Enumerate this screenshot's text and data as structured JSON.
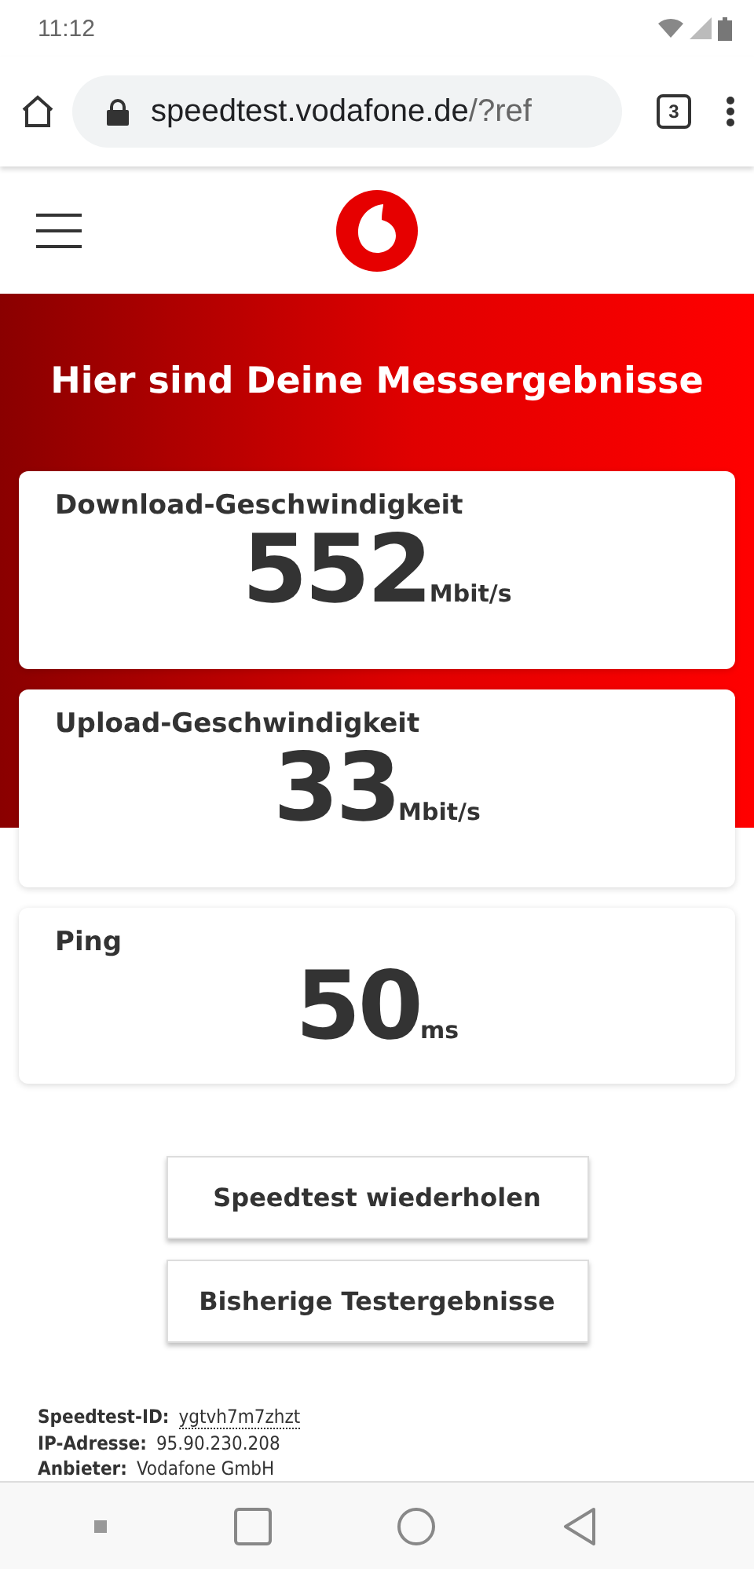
{
  "status_bar": {
    "time": "11:12"
  },
  "browser": {
    "url_host": "speedtest.vodafone.de",
    "url_rest": "/?ref",
    "tab_count": "3"
  },
  "banner": {
    "title": "Hier sind Deine Messergebnisse"
  },
  "results": [
    {
      "label": "Download-Geschwindigkeit",
      "value": "552",
      "unit": "Mbit/s"
    },
    {
      "label": "Upload-Geschwindigkeit",
      "value": "33",
      "unit": "Mbit/s"
    },
    {
      "label": "Ping",
      "value": "50",
      "unit": "ms"
    }
  ],
  "buttons": [
    "Speedtest wiederholen",
    "Bisherige Testergebnisse"
  ],
  "info": [
    {
      "label": "Speedtest-ID:",
      "value": "ygtvh7m7zhzt",
      "kind": "link"
    },
    {
      "label": "IP-Adresse:",
      "value": "95.90.230.208",
      "kind": "text"
    },
    {
      "label": "Anbieter:",
      "value": "Vodafone GmbH",
      "kind": "text"
    }
  ]
}
